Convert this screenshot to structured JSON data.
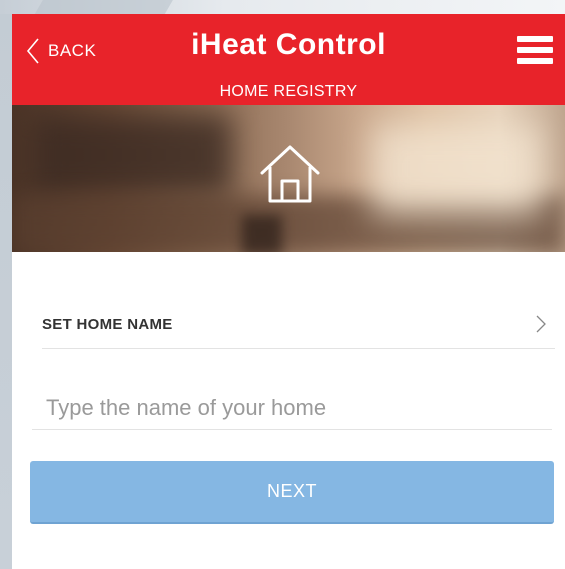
{
  "header": {
    "back_label": "BACK",
    "title": "iHeat Control",
    "subtitle": "HOME REGISTRY",
    "back_icon": "chevron-left-icon",
    "menu_icon": "hamburger-menu-icon",
    "color": "#e8232a"
  },
  "hero": {
    "icon": "home-icon"
  },
  "form": {
    "section_label": "SET HOME NAME",
    "section_icon": "chevron-right-icon",
    "name_value": "",
    "name_placeholder": "Type the name of your home",
    "next_label": "NEXT",
    "next_color": "#85b7e3"
  }
}
